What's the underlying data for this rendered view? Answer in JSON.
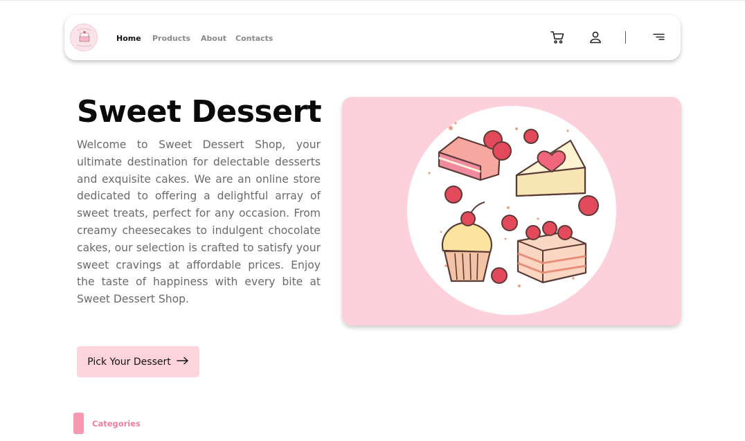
{
  "brand": {
    "logo_icon": "cake-logo-icon",
    "accent": "#fdd3dc",
    "category_accent": "#f59ab1"
  },
  "nav": {
    "links": [
      {
        "label": "Home",
        "active": true
      },
      {
        "label": "Products",
        "active": false
      },
      {
        "label": "About",
        "active": false
      },
      {
        "label": "Contacts",
        "active": false
      }
    ],
    "icons": [
      "cart-icon",
      "user-icon",
      "menu-icon"
    ]
  },
  "hero": {
    "title": "Sweet Dessert",
    "description": "Welcome to Sweet Dessert Shop, your ultimate destination for delectable desserts and exquisite cakes. We are an online store dedicated to offering a delightful array of sweet treats, perfect for any occasion. From creamy cheesecakes to indulgent chocolate cakes, our selection is crafted to satisfy your sweet cravings at affordable prices. Enjoy the taste of happiness with every bite at Sweet Dessert Shop.",
    "cta_label": "Pick Your Dessert",
    "cta_icon": "arrow-right-icon",
    "image": "desserts-illustration"
  },
  "categories": {
    "label": "Categories"
  }
}
